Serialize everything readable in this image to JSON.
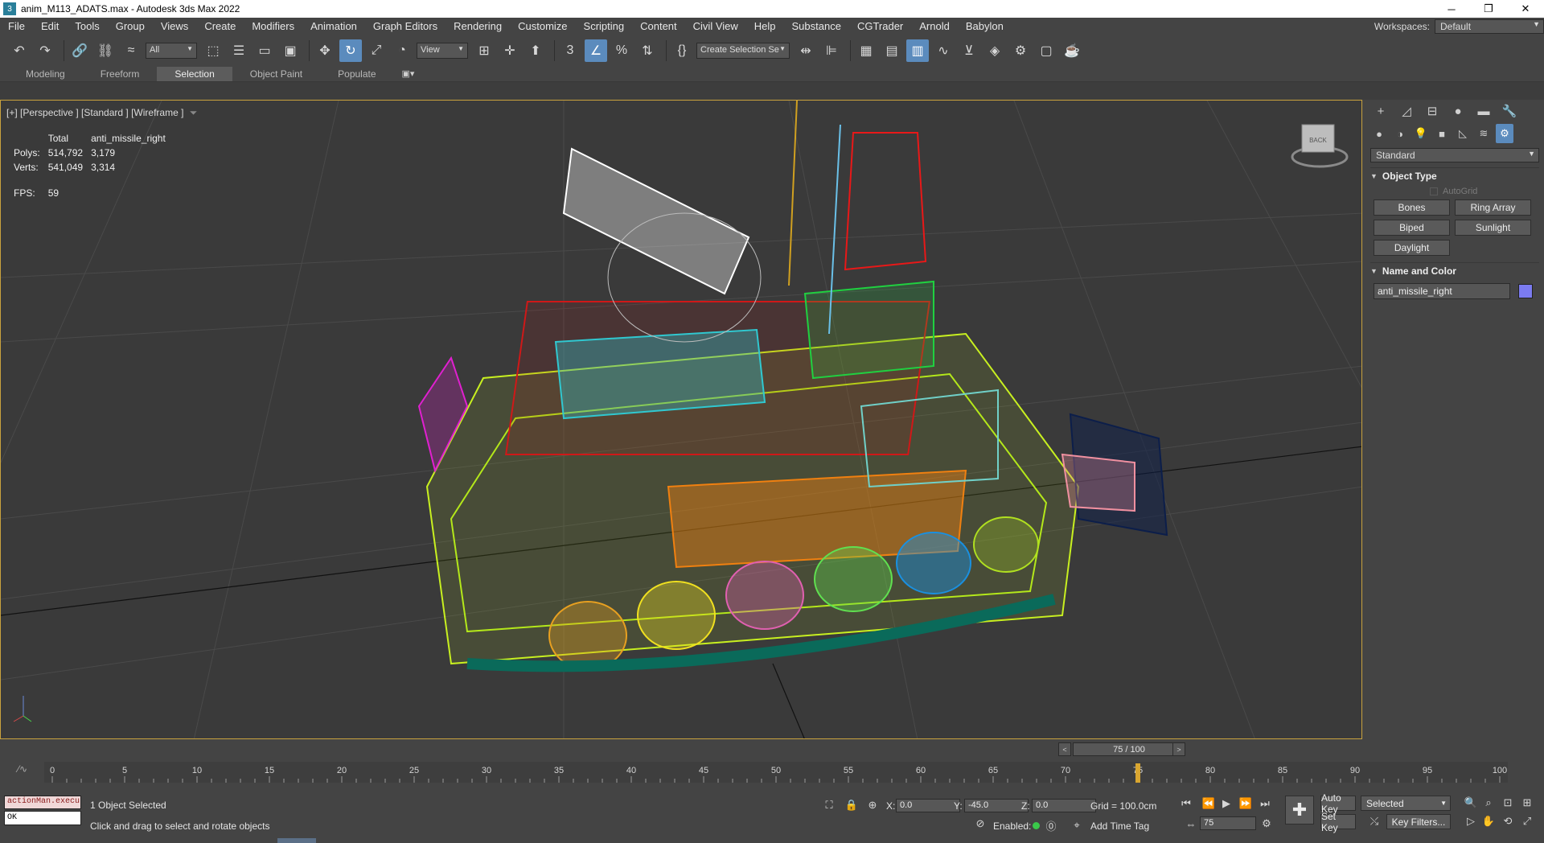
{
  "window": {
    "title": "anim_M113_ADATS.max - Autodesk 3ds Max 2022",
    "app_icon": "3",
    "minimize": "─",
    "restore": "❐",
    "close": "✕"
  },
  "menu": {
    "items": [
      "File",
      "Edit",
      "Tools",
      "Group",
      "Views",
      "Create",
      "Modifiers",
      "Animation",
      "Graph Editors",
      "Rendering",
      "Customize",
      "Scripting",
      "Content",
      "Civil View",
      "Help",
      "Substance",
      "CGTrader",
      "Arnold",
      "Babylon"
    ],
    "workspaces_label": "Workspaces:",
    "workspace_value": "Default"
  },
  "toolbar": {
    "filter_value": "All",
    "ref_coord_value": "View",
    "selection_set_value": "Create Selection Se"
  },
  "ribbon": {
    "tabs": [
      "Modeling",
      "Freeform",
      "Selection",
      "Object Paint",
      "Populate"
    ],
    "active_index": 2
  },
  "viewport": {
    "label": "[+] [Perspective ] [Standard ] [Wireframe ]",
    "stats": {
      "header_total": "Total",
      "header_object": "anti_missile_right",
      "polys_label": "Polys:",
      "polys_total": "514,792",
      "polys_object": "3,179",
      "verts_label": "Verts:",
      "verts_total": "541,049",
      "verts_object": "3,314",
      "fps_label": "FPS:",
      "fps_value": "59"
    },
    "viewcube_label": "BACK"
  },
  "command_panel": {
    "category_value": "Standard",
    "object_type_title": "Object Type",
    "autogrid_label": "AutoGrid",
    "buttons": [
      "Bones",
      "Ring Array",
      "Biped",
      "Sunlight",
      "Daylight"
    ],
    "name_color_title": "Name and Color",
    "object_name": "anti_missile_right",
    "object_color": "#7b7bf0"
  },
  "timeline": {
    "slider_text": "75 / 100",
    "prev_arrow": "<",
    "next_arrow": ">",
    "ticks": [
      "0",
      "5",
      "10",
      "15",
      "20",
      "25",
      "30",
      "35",
      "40",
      "45",
      "50",
      "55",
      "60",
      "65",
      "70",
      "75",
      "80",
      "85",
      "90",
      "95",
      "100"
    ],
    "current_frame": 75
  },
  "status": {
    "maxscript_listener": "actionMan.execu",
    "maxscript_output": "OK",
    "selected_text": "1 Object Selected",
    "prompt_text": "Click and drag to select and rotate objects",
    "x_label": "X:",
    "x_value": "0.0",
    "y_label": "Y:",
    "y_value": "-45.0",
    "z_label": "Z:",
    "z_value": "0.0",
    "grid_text": "Grid = 100.0cm",
    "enabled_label": "Enabled:",
    "add_time_tag": "Add Time Tag",
    "frame_value": "75",
    "auto_key": "Auto Key",
    "set_key": "Set Key",
    "key_mode_value": "Selected",
    "key_filters": "Key Filters..."
  }
}
